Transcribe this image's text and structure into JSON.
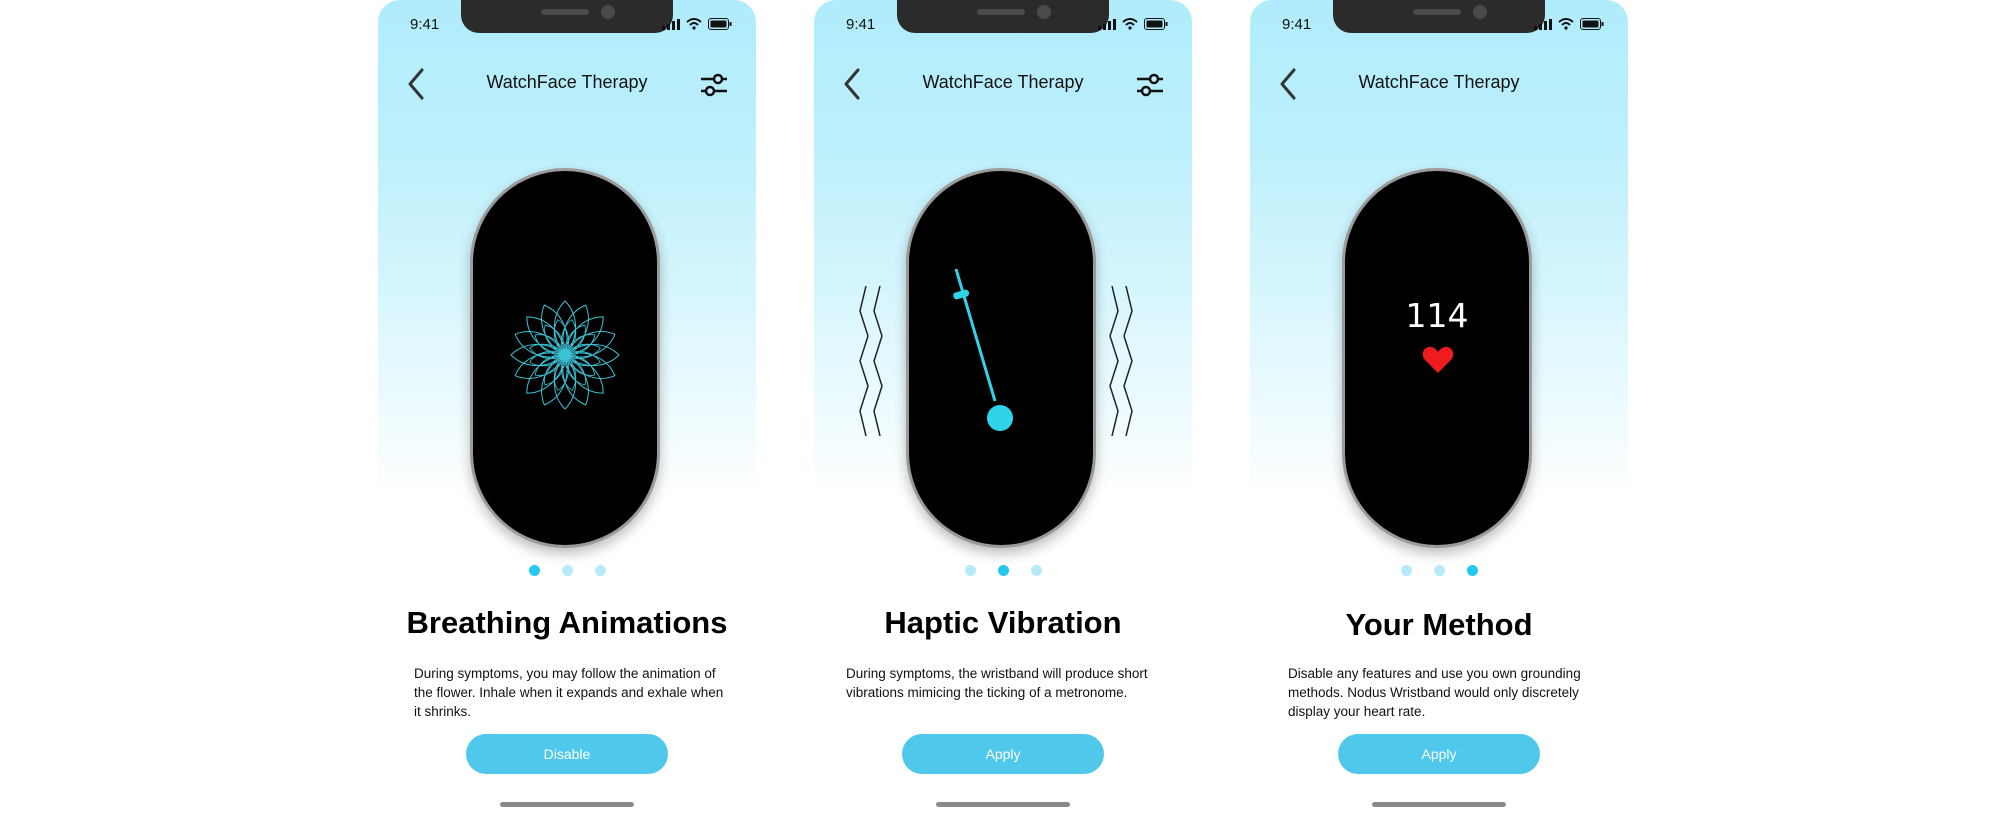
{
  "status": {
    "time": "9:41"
  },
  "screens": [
    {
      "header_title": "WatchFace Therapy",
      "heading": "Breathing Animations",
      "description": "During symptoms, you may follow the animation of the flower. Inhale when it expands and exhale when it shrinks.",
      "button_label": "Disable",
      "active_page": 1,
      "watch_content": "flower-animation-icon"
    },
    {
      "header_title": "WatchFace Therapy",
      "heading": "Haptic Vibration",
      "description": "During symptoms, the wristband will produce short vibrations mimicing the ticking of a metronome.",
      "button_label": "Apply",
      "active_page": 2,
      "watch_content": "metronome-icon"
    },
    {
      "header_title": "WatchFace Therapy",
      "heading": "Your Method",
      "description": "Disable any features and use you own grounding methods. Nodus Wristband would only discretely display your heart rate.",
      "button_label": "Apply",
      "active_page": 3,
      "watch_content": "heart-rate",
      "heart_rate": "114"
    }
  ],
  "colors": {
    "accent": "#4fc8ec",
    "dot_active": "#27c8ee",
    "dot_inactive": "#b6eafb",
    "heart": "#ee1c1c",
    "flower": "#3cc4d6"
  }
}
